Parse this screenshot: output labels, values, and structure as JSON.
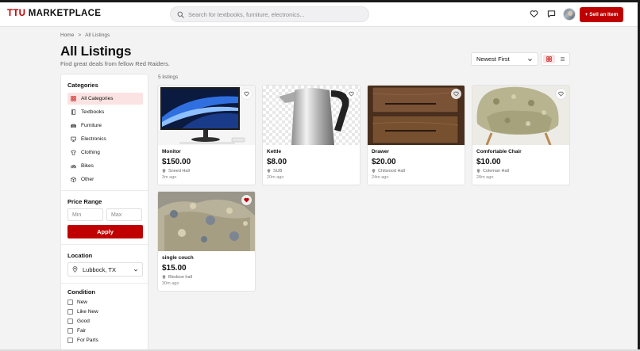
{
  "header": {
    "logo_ttu": "TTU",
    "logo_rest": " MARKETPLACE",
    "search_placeholder": "Search for textbooks, furniture, electronics...",
    "sell_label": "+ Sell an Item"
  },
  "breadcrumb": {
    "home": "Home",
    "separator": ">",
    "current": "All Listings"
  },
  "page": {
    "title": "All Listings",
    "subtitle": "Find great deals from fellow Red Raiders."
  },
  "sort": {
    "selected": "Newest First"
  },
  "view": {
    "active": "grid"
  },
  "sidebar": {
    "categories_title": "Categories",
    "categories": [
      {
        "label": "All Categories",
        "icon": "grid-icon",
        "active": true
      },
      {
        "label": "Textbooks",
        "icon": "book-icon",
        "active": false
      },
      {
        "label": "Furniture",
        "icon": "sofa-icon",
        "active": false
      },
      {
        "label": "Electronics",
        "icon": "monitor-icon",
        "active": false
      },
      {
        "label": "Clothing",
        "icon": "shirt-icon",
        "active": false
      },
      {
        "label": "Bikes",
        "icon": "bike-icon",
        "active": false
      },
      {
        "label": "Other",
        "icon": "box-icon",
        "active": false
      }
    ],
    "price_title": "Price Range",
    "min_placeholder": "Min",
    "max_placeholder": "Max",
    "apply_label": "Apply",
    "location_title": "Location",
    "location_value": "Lubbock, TX",
    "condition_title": "Condition",
    "conditions": [
      "New",
      "Like New",
      "Good",
      "Fair",
      "For Parts"
    ]
  },
  "listings": {
    "count": "5 listings",
    "items": [
      {
        "title": "Monitor",
        "price": "$150.00",
        "location": "Sneed Hall",
        "time": "3m ago",
        "favorited": false
      },
      {
        "title": "Kettle",
        "price": "$8.00",
        "location": "SUB",
        "time": "20m ago",
        "favorited": false
      },
      {
        "title": "Drawer",
        "price": "$20.00",
        "location": "Chitwood Hall",
        "time": "24m ago",
        "favorited": false
      },
      {
        "title": "Comfortable Chair",
        "price": "$10.00",
        "location": "Coleman Hall",
        "time": "28m ago",
        "favorited": false
      },
      {
        "title": "single couch",
        "price": "$15.00",
        "location": "Bledsoe hall",
        "time": "30m ago",
        "favorited": true
      }
    ]
  },
  "colors": {
    "brand": "#c00000",
    "active_bg": "#fbe3e3"
  }
}
